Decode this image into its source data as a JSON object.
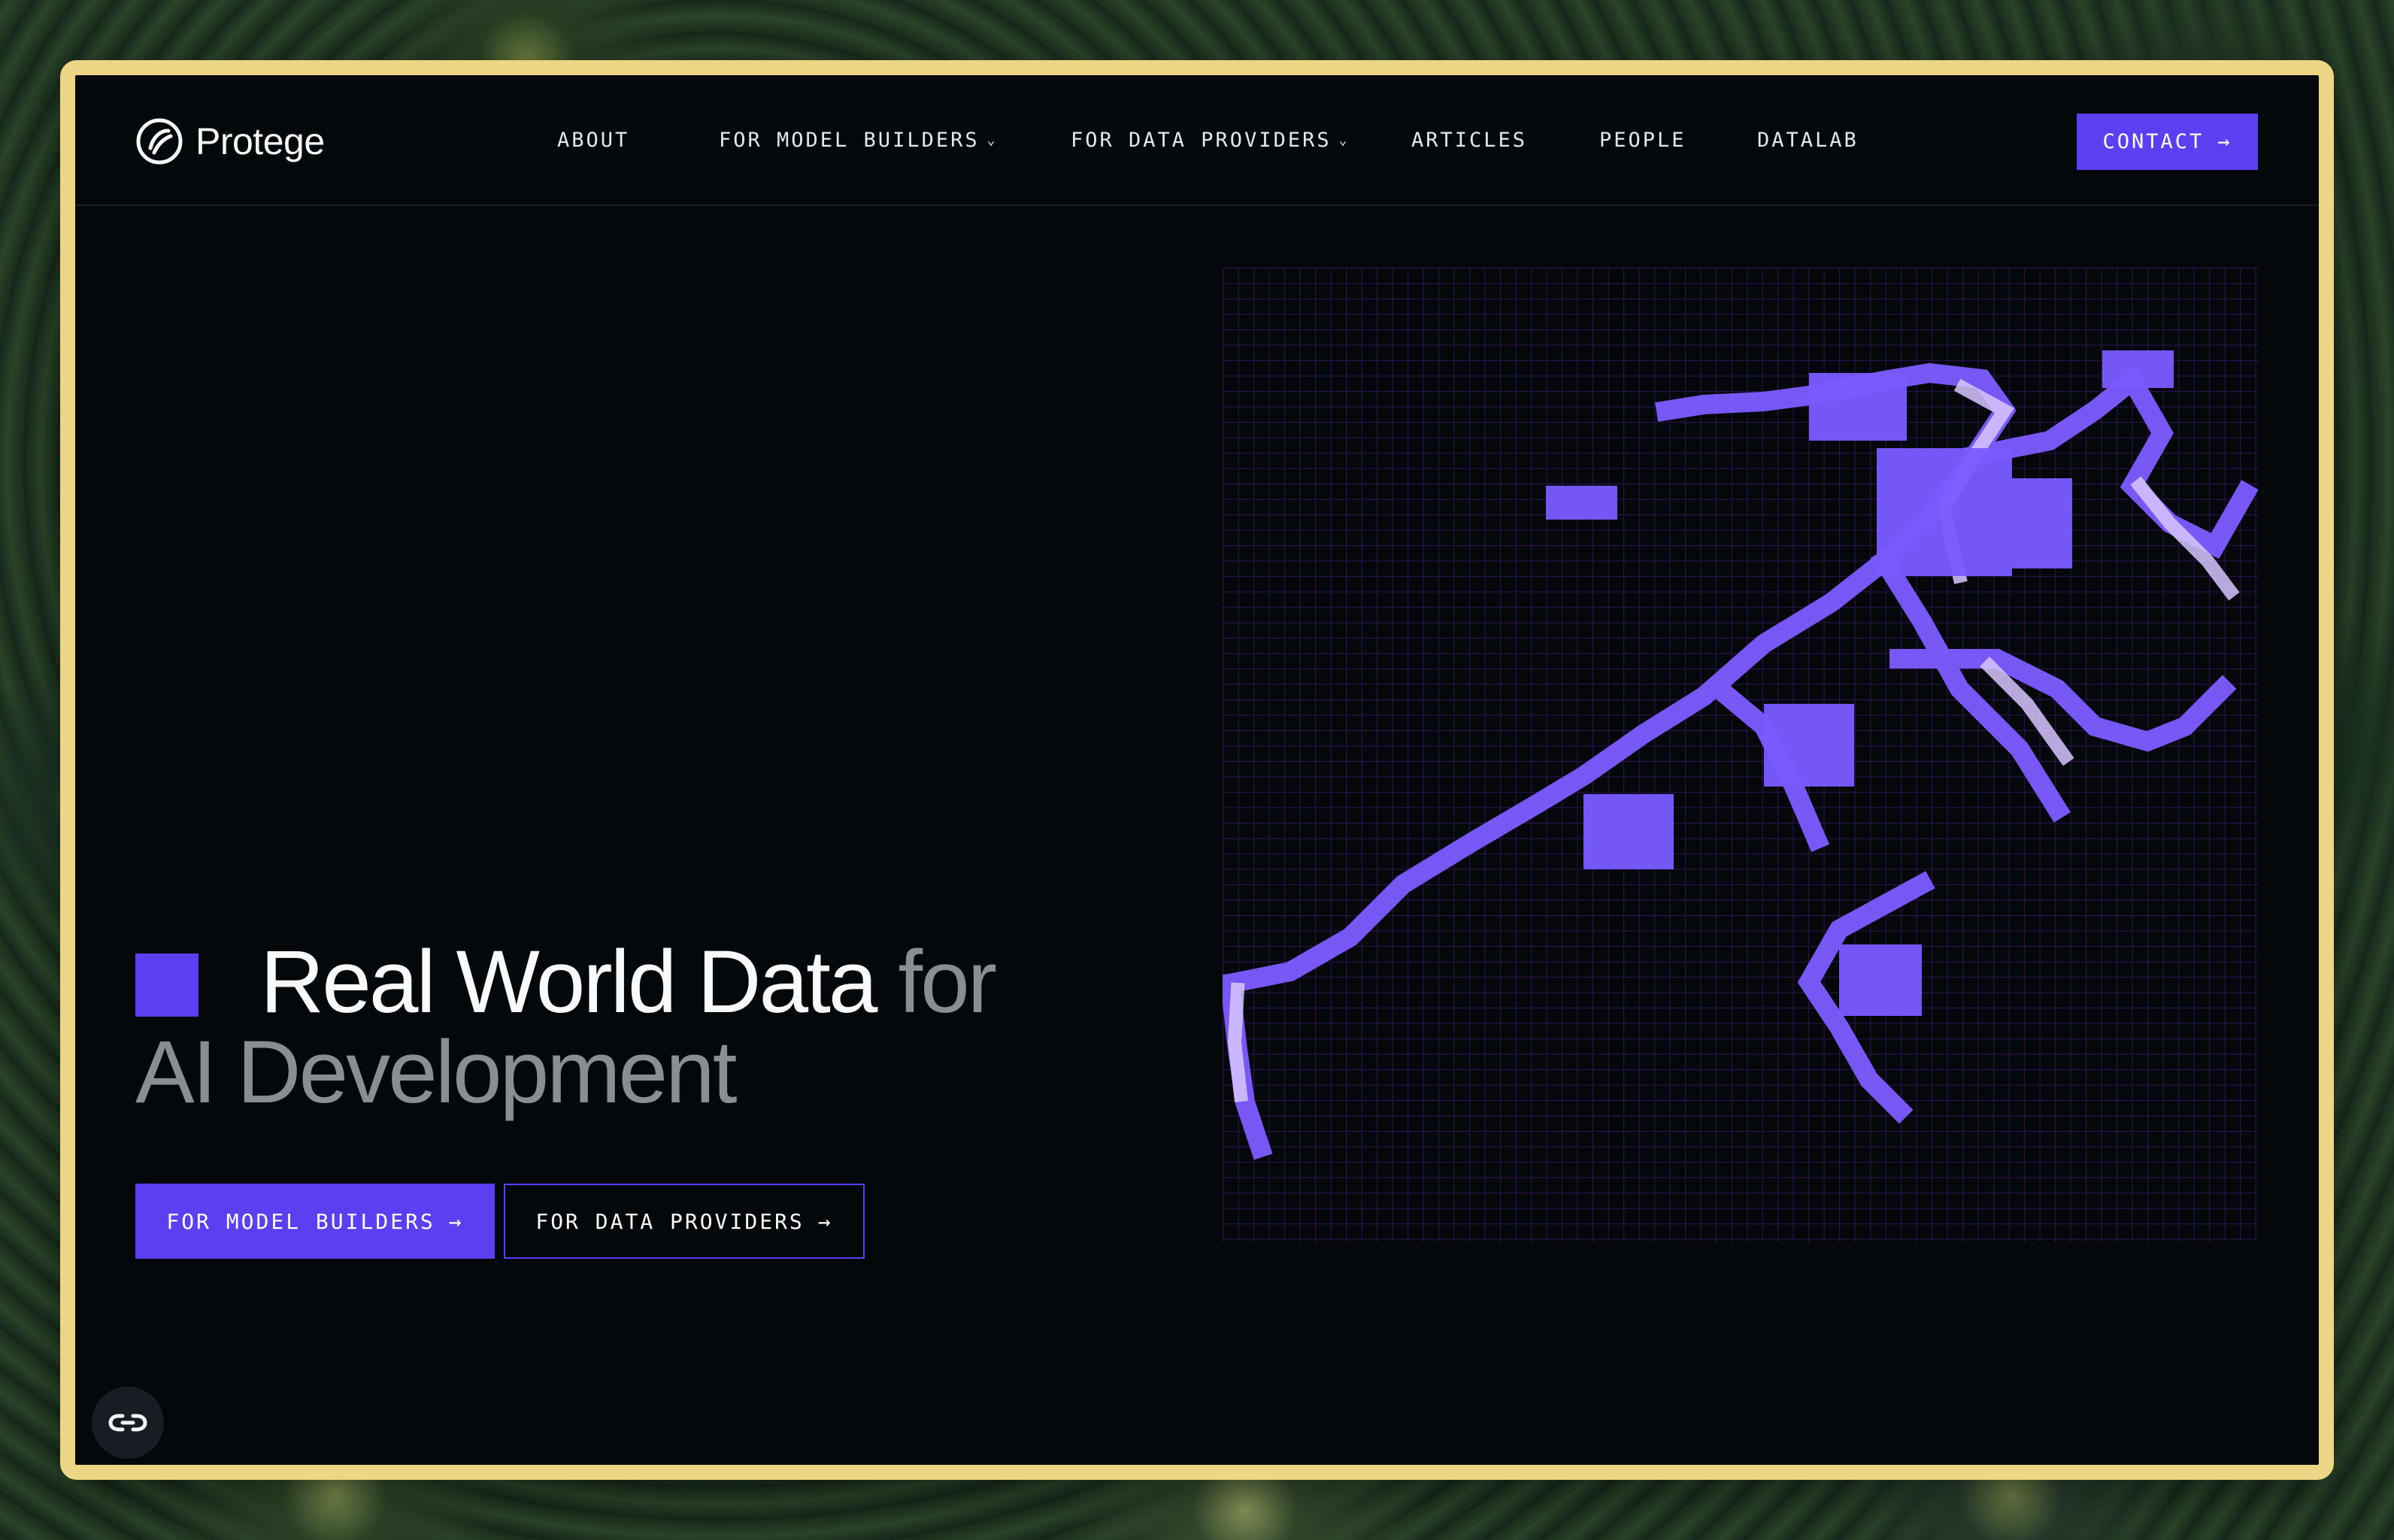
{
  "brand": {
    "name": "Protege",
    "logo_icon": "protege-logo-icon"
  },
  "nav": {
    "items": [
      {
        "label": "ABOUT",
        "has_dropdown": false
      },
      {
        "label": "FOR MODEL BUILDERS",
        "has_dropdown": true
      },
      {
        "label": "FOR DATA PROVIDERS",
        "has_dropdown": true
      },
      {
        "label": "ARTICLES",
        "has_dropdown": false
      },
      {
        "label": "PEOPLE",
        "has_dropdown": false
      },
      {
        "label": "DATALAB",
        "has_dropdown": false
      }
    ],
    "contact_label": "CONTACT",
    "dropdown_icon": "chevron-down-icon",
    "arrow_icon": "arrow-right-icon"
  },
  "hero": {
    "headline_strong": "Real World Data",
    "headline_dim": "for",
    "headline_line2": "AI Development",
    "cta_primary": "FOR MODEL BUILDERS",
    "cta_secondary": "FOR DATA PROVIDERS",
    "illustration": "pixelated-purple-tree-map"
  },
  "chat": {
    "icon": "chat-link-icon"
  },
  "colors": {
    "accent": "#5b3ff0",
    "frame": "#ecd585",
    "background": "#05080b",
    "text": "#f8f9fa",
    "muted_text": "#8a8d91",
    "pixel_grid": "#2b1150",
    "pixel_light": "#d7c7ff"
  }
}
